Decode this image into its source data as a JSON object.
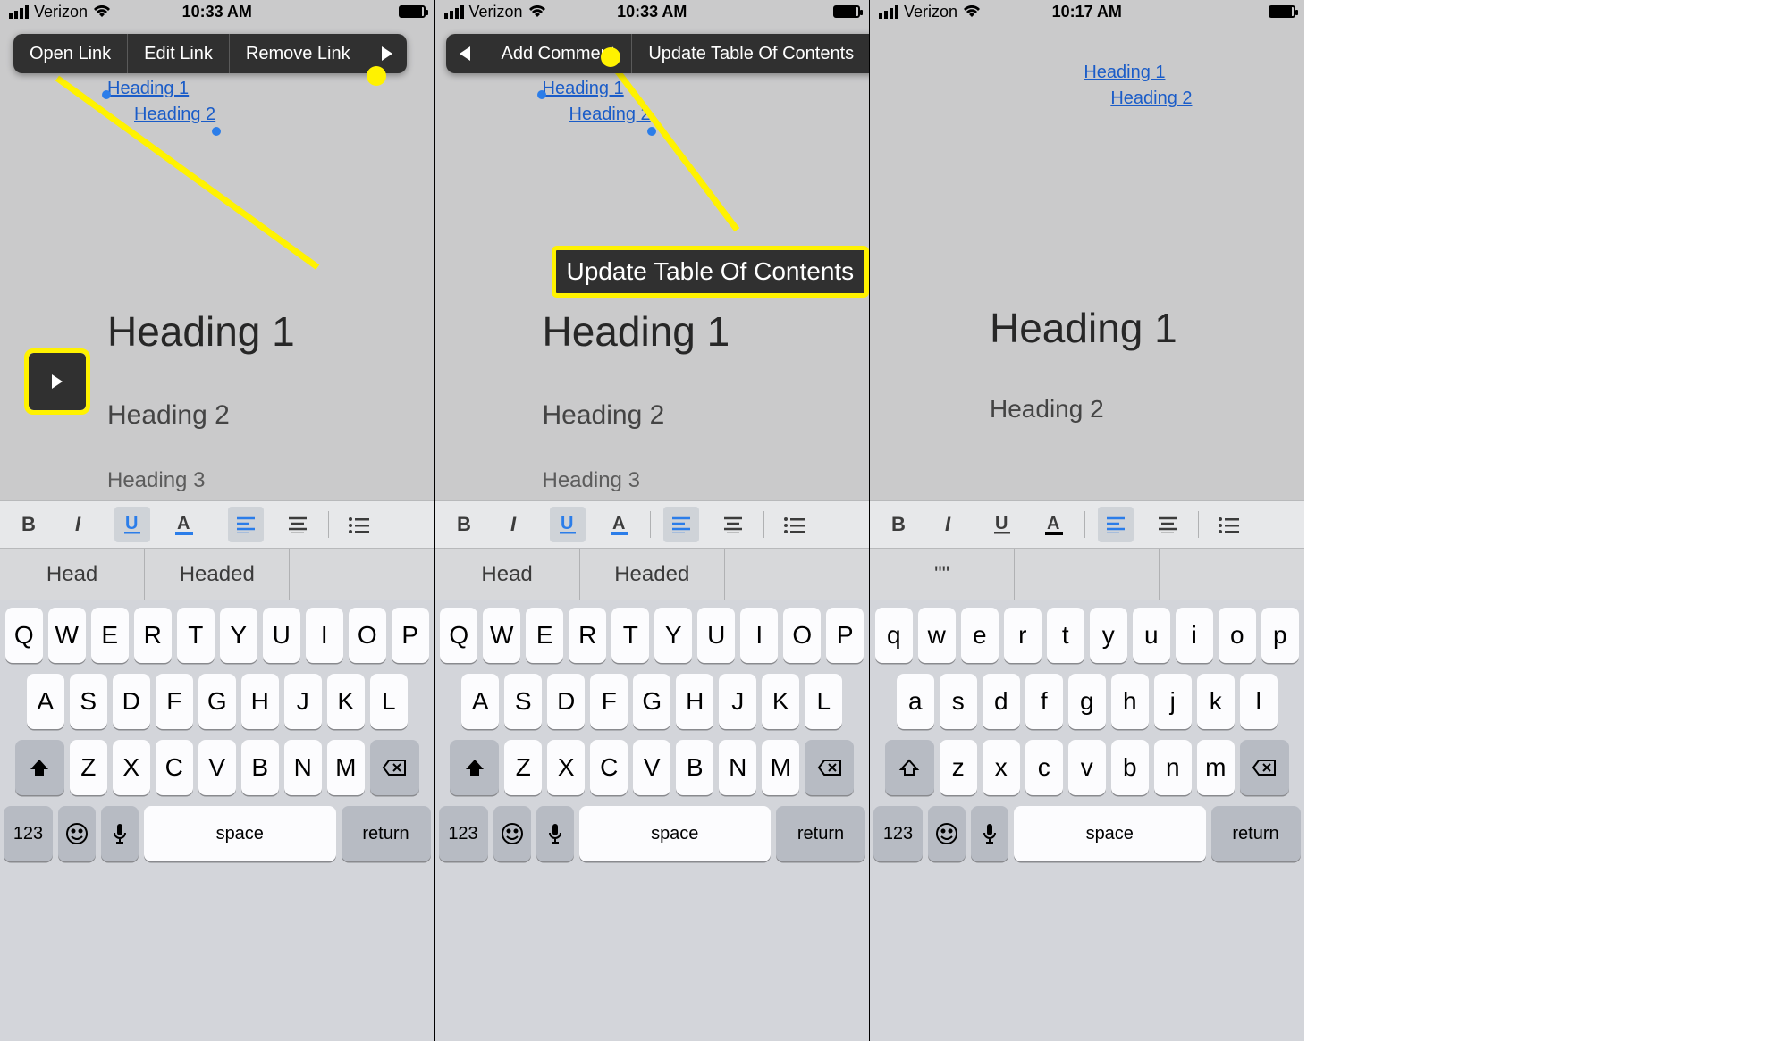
{
  "status": {
    "carrier": "Verizon",
    "time_ab": "10:33 AM",
    "time_c": "10:17 AM"
  },
  "menu_a": {
    "open_link": "Open Link",
    "edit_link": "Edit Link",
    "remove_link": "Remove Link"
  },
  "menu_b": {
    "add_comment": "Add Comment",
    "update_toc": "Update Table Of Contents"
  },
  "toc": {
    "h1": "Heading 1",
    "h2": "Heading 2"
  },
  "doc": {
    "h1": "Heading 1",
    "h2": "Heading 2",
    "h3": "Heading 3"
  },
  "callout": {
    "update_toc": "Update Table Of Contents"
  },
  "sugg_ab": {
    "s1": "Head",
    "s2": "Headed",
    "s3": ""
  },
  "sugg_c": {
    "s1": "\"\""
  },
  "kb_upper": {
    "r1": [
      "Q",
      "W",
      "E",
      "R",
      "T",
      "Y",
      "U",
      "I",
      "O",
      "P"
    ],
    "r2": [
      "A",
      "S",
      "D",
      "F",
      "G",
      "H",
      "J",
      "K",
      "L"
    ],
    "r3": [
      "Z",
      "X",
      "C",
      "V",
      "B",
      "N",
      "M"
    ]
  },
  "kb_lower": {
    "r1": [
      "q",
      "w",
      "e",
      "r",
      "t",
      "y",
      "u",
      "i",
      "o",
      "p"
    ],
    "r2": [
      "a",
      "s",
      "d",
      "f",
      "g",
      "h",
      "j",
      "k",
      "l"
    ],
    "r3": [
      "z",
      "x",
      "c",
      "v",
      "b",
      "n",
      "m"
    ]
  },
  "kb_fn": {
    "n123": "123",
    "space": "space",
    "ret": "return"
  }
}
